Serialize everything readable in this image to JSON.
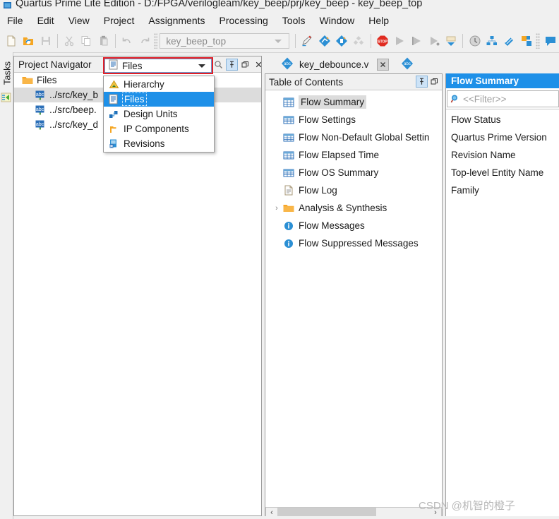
{
  "window": {
    "title": "Quartus Prime Lite Edition - D:/FPGA/verilogleam/key_beep/prj/key_beep - key_beep_top",
    "icon": "quartus-app-icon"
  },
  "menubar": {
    "items": [
      {
        "label": "File"
      },
      {
        "label": "Edit"
      },
      {
        "label": "View"
      },
      {
        "label": "Project"
      },
      {
        "label": "Assignments"
      },
      {
        "label": "Processing"
      },
      {
        "label": "Tools"
      },
      {
        "label": "Window"
      },
      {
        "label": "Help"
      }
    ]
  },
  "toolbar": {
    "revision_combo": {
      "value": "key_beep_top"
    },
    "buttons": [
      {
        "name": "new-file-icon",
        "title": "New"
      },
      {
        "name": "open-project-icon",
        "title": "Open"
      },
      {
        "name": "save-icon",
        "title": "Save"
      },
      {
        "name": "cut-icon",
        "title": "Cut"
      },
      {
        "name": "copy-icon",
        "title": "Copy"
      },
      {
        "name": "paste-icon",
        "title": "Paste"
      },
      {
        "name": "undo-icon",
        "title": "Undo"
      },
      {
        "name": "redo-icon",
        "title": "Redo"
      },
      {
        "name": "pin-assignment-icon",
        "title": "Pin Planner"
      },
      {
        "name": "settings-icon",
        "title": "Settings"
      },
      {
        "name": "device-icon",
        "title": "Device"
      },
      {
        "name": "assignment-editor-icon",
        "title": "Assignment Editor"
      },
      {
        "name": "stop-icon",
        "title": "Stop Processing"
      },
      {
        "name": "start-compilation-icon",
        "title": "Start Compilation"
      },
      {
        "name": "start-analysis-icon",
        "title": "Start Analysis & Elaboration"
      },
      {
        "name": "analysis-synthesis-icon",
        "title": "Start Analysis & Synthesis"
      },
      {
        "name": "programmer-icon",
        "title": "Programmer"
      },
      {
        "name": "timing-analyzer-icon",
        "title": "Timing Analyzer"
      },
      {
        "name": "netlist-viewer-icon",
        "title": "Netlist Viewers"
      },
      {
        "name": "signaltap-icon",
        "title": "Signal Tap"
      },
      {
        "name": "platform-designer-icon",
        "title": "Platform Designer"
      },
      {
        "name": "message-icon",
        "title": "Messages"
      }
    ]
  },
  "left_tabstrip": {
    "label": "Tasks",
    "icon": "tasks-icon"
  },
  "project_navigator": {
    "title": "Project Navigator",
    "view_combo": {
      "value": "Files",
      "icon": "files-icon",
      "options": [
        {
          "label": "Hierarchy",
          "icon": "hierarchy-icon",
          "selected": false
        },
        {
          "label": "Files",
          "icon": "files-icon",
          "selected": true
        },
        {
          "label": "Design Units",
          "icon": "design-units-icon",
          "selected": false
        },
        {
          "label": "IP Components",
          "icon": "ip-components-icon",
          "selected": false
        },
        {
          "label": "Revisions",
          "icon": "revisions-icon",
          "selected": false
        }
      ]
    },
    "header_buttons": [
      {
        "name": "search-icon",
        "label": "Search"
      },
      {
        "name": "pin-icon",
        "label": "Pin",
        "active": true
      },
      {
        "name": "maximize-icon",
        "label": "Maximize"
      },
      {
        "name": "close-icon",
        "label": "Close"
      }
    ],
    "tree": {
      "root": {
        "label": "Files",
        "icon": "folder-icon"
      },
      "items": [
        {
          "label": "../src/key_b",
          "icon": "verilog-file-icon",
          "selected": true
        },
        {
          "label": "../src/beep.",
          "icon": "verilog-file-icon",
          "selected": false
        },
        {
          "label": "../src/key_d",
          "icon": "verilog-file-icon",
          "selected": false
        }
      ]
    }
  },
  "report_tab": {
    "label": "key_debounce.v",
    "icon": "verilog-file-icon",
    "close_label": "x"
  },
  "table_of_contents": {
    "title": "Table of Contents",
    "header_buttons": [
      {
        "name": "pin-icon",
        "label": "Pin",
        "active": true
      },
      {
        "name": "maximize-icon",
        "label": "Maximize"
      }
    ],
    "items": [
      {
        "label": "Flow Summary",
        "icon": "report-table-icon",
        "selected": true,
        "expandable": false
      },
      {
        "label": "Flow Settings",
        "icon": "report-table-icon",
        "selected": false,
        "expandable": false
      },
      {
        "label": "Flow Non-Default Global Settin",
        "icon": "report-table-icon",
        "selected": false,
        "expandable": false
      },
      {
        "label": "Flow Elapsed Time",
        "icon": "report-table-icon",
        "selected": false,
        "expandable": false
      },
      {
        "label": "Flow OS Summary",
        "icon": "report-table-icon",
        "selected": false,
        "expandable": false
      },
      {
        "label": "Flow Log",
        "icon": "report-log-icon",
        "selected": false,
        "expandable": false
      },
      {
        "label": "Analysis & Synthesis",
        "icon": "folder-icon",
        "selected": false,
        "expandable": true
      },
      {
        "label": "Flow Messages",
        "icon": "info-icon",
        "selected": false,
        "expandable": false
      },
      {
        "label": "Flow Suppressed Messages",
        "icon": "info-icon",
        "selected": false,
        "expandable": false
      }
    ]
  },
  "flow_summary": {
    "title": "Flow Summary",
    "filter": {
      "placeholder": "<<Filter>>",
      "value": "",
      "icon": "search-icon"
    },
    "rows": [
      {
        "label": "Flow Status"
      },
      {
        "label": "Quartus Prime Version"
      },
      {
        "label": "Revision Name"
      },
      {
        "label": "Top-level Entity Name"
      },
      {
        "label": "Family"
      }
    ]
  },
  "scrollbar": {
    "left_arrow": "‹",
    "right_arrow": "›"
  },
  "watermark": {
    "text": "CSDN @机智的橙子"
  },
  "colors": {
    "accent_blue": "#1e90e8",
    "highlight_red": "#e31f26",
    "panel_bg": "#f0f0f0",
    "selection_gray": "#dcdcdc"
  }
}
